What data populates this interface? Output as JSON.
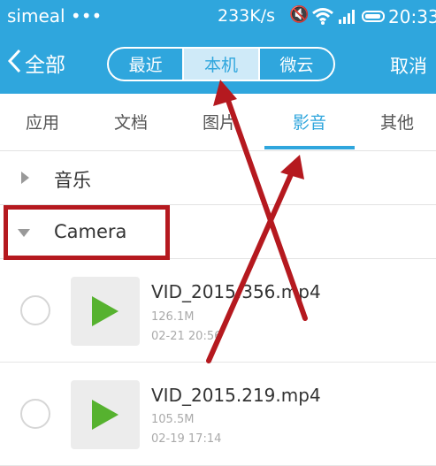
{
  "status_bar": {
    "carrier": "simeal •••",
    "speed": "233K/s",
    "time": "20:33",
    "icons": [
      "mute-icon",
      "wifi-icon",
      "signal-icon",
      "battery-icon"
    ]
  },
  "nav": {
    "back_label": "全部",
    "segments": [
      "最近",
      "本机",
      "微云"
    ],
    "active_segment": "本机",
    "cancel_label": "取消"
  },
  "tabs": {
    "items": [
      "应用",
      "文档",
      "图片",
      "影音",
      "其他"
    ],
    "active": "影音"
  },
  "groups": [
    {
      "title": "音乐",
      "expanded": false
    },
    {
      "title": "Camera",
      "expanded": true
    }
  ],
  "files": [
    {
      "name": "VID_2015.356.mp4",
      "size": "126.1M",
      "date": "02-21 20:56",
      "selected": false
    },
    {
      "name": "VID_2015.219.mp4",
      "size": "105.5M",
      "date": "02-19 17:14",
      "selected": false
    }
  ],
  "colors": {
    "accent": "#2fa6dd",
    "annotation": "#b5191f",
    "play": "#56b22f"
  }
}
